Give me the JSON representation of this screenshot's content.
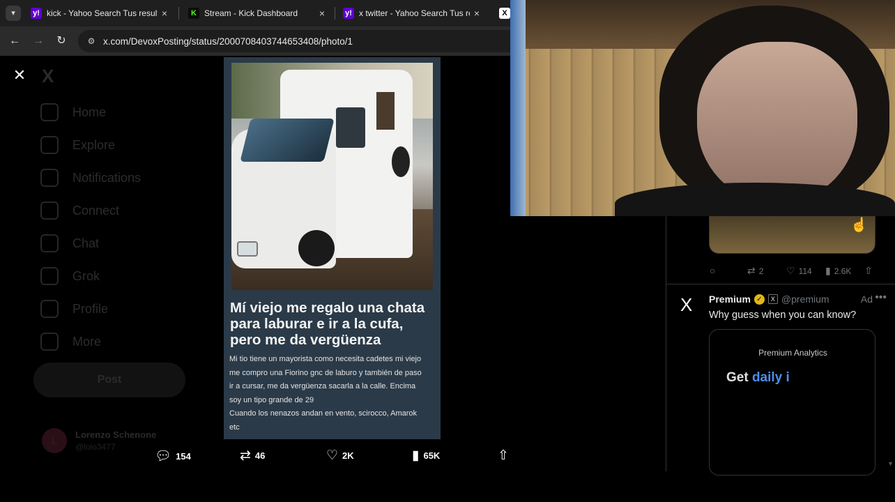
{
  "browser": {
    "tabs": [
      {
        "title": "kick - Yahoo Search Tus resultados",
        "favicon": "yahoo-icon"
      },
      {
        "title": "Stream - Kick Dashboard",
        "favicon": "kick-icon"
      },
      {
        "title": "x twitter - Yahoo Search Tus resultados",
        "favicon": "yahoo-icon"
      },
      {
        "title": "",
        "favicon": "x-icon"
      }
    ],
    "tab_close": "×",
    "url": "x.com/DevoxPosting/status/2000708403744653408/photo/1",
    "favicon_letters": {
      "yahoo": "y!",
      "kick": "K",
      "x": "X"
    }
  },
  "sidebar": {
    "items": [
      {
        "label": "Home"
      },
      {
        "label": "Explore"
      },
      {
        "label": "Notifications"
      },
      {
        "label": "Connect"
      },
      {
        "label": "Chat"
      },
      {
        "label": "Grok"
      },
      {
        "label": "Profile"
      },
      {
        "label": "More"
      }
    ],
    "post_label": "Post",
    "account": {
      "name": "Lorenzo Schenone",
      "handle": "@lolo3477",
      "initial": "L"
    }
  },
  "photo": {
    "headline": "Mí viejo me regalo una chata para laburar e ir a la cufa, pero me da vergüenza",
    "body_lines": [
      "Mi tio tiene un mayorista como necesita cadetes mi viejo",
      "me compro una Fiorino gnc de laburo y también de paso",
      "ir a cursar, me da vergüenza sacarla a la calle. Encima",
      "soy un tipo grande de 29",
      "Cuando los nenazos andan en vento, scirocco, Amarok",
      "etc"
    ]
  },
  "actions": {
    "replies": "154",
    "reposts": "46",
    "likes": "2K",
    "views": "65K"
  },
  "right_timeline": {
    "prev_post_metrics": {
      "reposts": "2",
      "likes": "114",
      "views": "2.6K"
    },
    "ad": {
      "name": "Premium",
      "handle": "@premium",
      "tag": "Ad",
      "text": "Why guess when you can know?",
      "card_brand": "Premium Analytics",
      "card_headline": "Get daily i",
      "card_headline_accent": "daily i"
    }
  },
  "colors": {
    "accent_blue": "#1d9bf0",
    "yahoo_purple": "#6001d2",
    "kick_green": "#53fc18",
    "verified_gold": "#e2b719"
  }
}
